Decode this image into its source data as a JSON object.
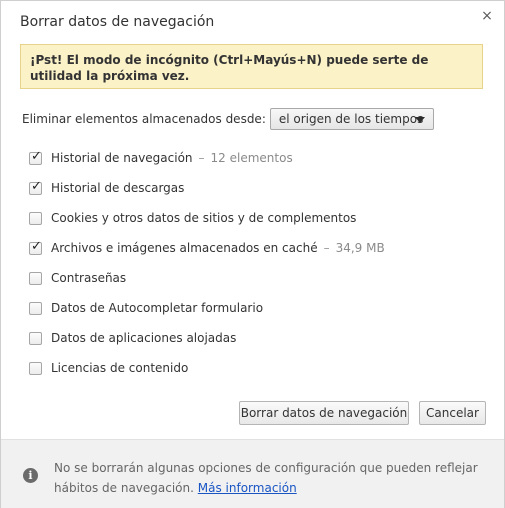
{
  "dialog": {
    "title": "Borrar datos de navegación",
    "close_symbol": "×"
  },
  "tip": {
    "text": "¡Pst! El modo de incógnito (Ctrl+Mayús+N) puede serte de utilidad la próxima vez."
  },
  "from": {
    "label": "Eliminar elementos almacenados desde:",
    "selected": "el origen de los tiempos"
  },
  "options": [
    {
      "label": "Historial de navegación",
      "checked": true,
      "detail": "12 elementos"
    },
    {
      "label": "Historial de descargas",
      "checked": true,
      "detail": ""
    },
    {
      "label": "Cookies y otros datos de sitios y de complementos",
      "checked": false,
      "detail": ""
    },
    {
      "label": "Archivos e imágenes almacenados en caché",
      "checked": true,
      "detail": "34,9 MB"
    },
    {
      "label": "Contraseñas",
      "checked": false,
      "detail": ""
    },
    {
      "label": "Datos de Autocompletar formulario",
      "checked": false,
      "detail": ""
    },
    {
      "label": "Datos de aplicaciones alojadas",
      "checked": false,
      "detail": ""
    },
    {
      "label": "Licencias de contenido",
      "checked": false,
      "detail": ""
    }
  ],
  "option_separator": "–",
  "check_mark": "✓",
  "buttons": {
    "clear_label": "Borrar datos de navegación",
    "cancel_label": "Cancelar"
  },
  "footer": {
    "text": "No se borrarán algunas opciones de configuración que pueden reflejar hábitos de navegación.",
    "link_label": "Más información",
    "info_symbol": "i"
  },
  "colors": {
    "tip_background": "#fbf2c8",
    "tip_border": "#e7d48a",
    "link": "#1a55c4",
    "footer_background": "#f1f1f1",
    "detail_text": "#8a8a8a"
  },
  "icons": {
    "close": "close-icon",
    "dropdown": "chevron-down-icon",
    "info": "info-icon"
  }
}
